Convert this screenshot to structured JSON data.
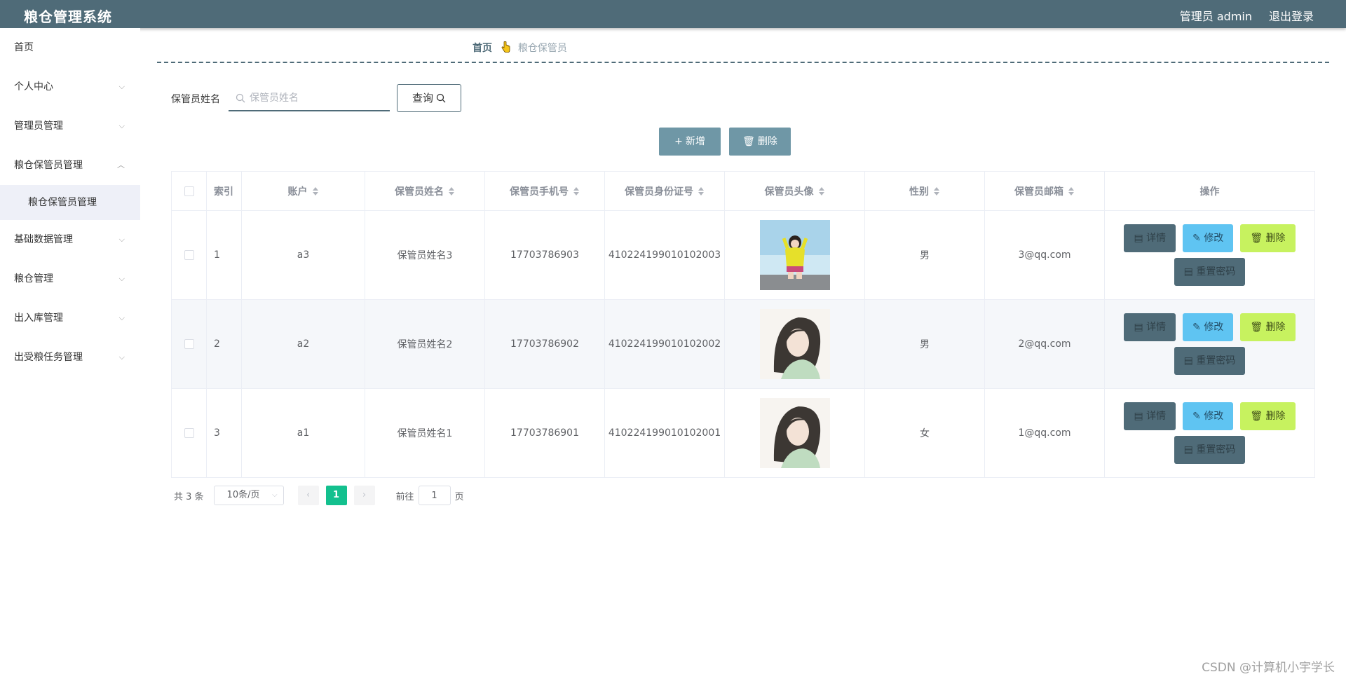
{
  "header": {
    "title": "粮仓管理系统",
    "user": "管理员 admin",
    "logout": "退出登录"
  },
  "sidebar": {
    "items": [
      {
        "label": "首页"
      },
      {
        "label": "个人中心"
      },
      {
        "label": "管理员管理"
      },
      {
        "label": "粮仓保管员管理",
        "expanded": true,
        "sub": "粮仓保管员管理"
      },
      {
        "label": "基础数据管理"
      },
      {
        "label": "粮仓管理"
      },
      {
        "label": "出入库管理"
      },
      {
        "label": "出受粮任务管理"
      }
    ]
  },
  "breadcrumb": {
    "home": "首页",
    "current": "粮仓保管员"
  },
  "search": {
    "label": "保管员姓名",
    "placeholder": "保管员姓名",
    "value": "",
    "button": "查询"
  },
  "actions": {
    "add": "新增",
    "delete": "删除"
  },
  "table": {
    "headers": [
      "索引",
      "账户",
      "保管员姓名",
      "保管员手机号",
      "保管员身份证号",
      "保管员头像",
      "性别",
      "保管员邮箱",
      "操作"
    ],
    "rows": [
      {
        "idx": "1",
        "account": "a3",
        "name": "保管员姓名3",
        "phone": "17703786903",
        "idcard": "410224199010102003",
        "sex": "男",
        "email": "3@qq.com"
      },
      {
        "idx": "2",
        "account": "a2",
        "name": "保管员姓名2",
        "phone": "17703786902",
        "idcard": "410224199010102002",
        "sex": "男",
        "email": "2@qq.com"
      },
      {
        "idx": "3",
        "account": "a1",
        "name": "保管员姓名1",
        "phone": "17703786901",
        "idcard": "410224199010102001",
        "sex": "女",
        "email": "1@qq.com"
      }
    ],
    "ops": {
      "detail": "详情",
      "edit": "修改",
      "delete": "删除",
      "reset": "重置密码"
    }
  },
  "pagination": {
    "total": "共 3 条",
    "size": "10条/页",
    "current": "1",
    "goto_prefix": "前往",
    "goto_value": "1",
    "goto_suffix": "页"
  },
  "watermark": "CSDN @计算机小宇学长",
  "colors": {
    "header": "#4f6b78",
    "accent_green": "#13c08e",
    "edit": "#5fc4f2",
    "delete": "#c7f25f"
  }
}
